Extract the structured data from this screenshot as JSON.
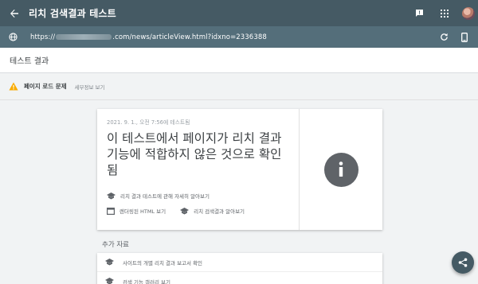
{
  "appbar": {
    "title": "리치 검색결과 테스트",
    "back_icon": "arrow-back-icon",
    "actions": [
      "feedback-icon",
      "apps-grid-icon",
      "avatar"
    ]
  },
  "urlbar": {
    "url_prefix": "https://",
    "url_suffix": ".com/news/articleView.html?idxno=2336388",
    "icons": [
      "globe-icon",
      "refresh-icon",
      "device-icon"
    ]
  },
  "header": {
    "title": "테스트 결과"
  },
  "issue": {
    "label": "페이지 로드 문제",
    "link": "세부정보 보기",
    "icon": "warning-icon"
  },
  "result_card": {
    "date": "2021. 9. 1., 오전 7:56에 테스트됨",
    "headline": "이 테스트에서 페이지가 리치 결과 기능에 적합하지 않은 것으로 확인됨",
    "link_learn_more": "리치 결과 테스트에 관해 자세히 알아보기",
    "link_rendered_html": "렌더링된 HTML 보기",
    "link_rich_results": "리치 검색결과 알아보기",
    "status_icon": "info-icon"
  },
  "additional": {
    "title": "추가 자료",
    "items": [
      "사이트의 개별 리치 결과 보고서 확인",
      "검색 기능 갤러리 보기"
    ]
  },
  "colors": {
    "appbar": "#455a64",
    "urlbar": "#546e7a",
    "warning": "#f9ab00",
    "info": "#5f6368"
  }
}
